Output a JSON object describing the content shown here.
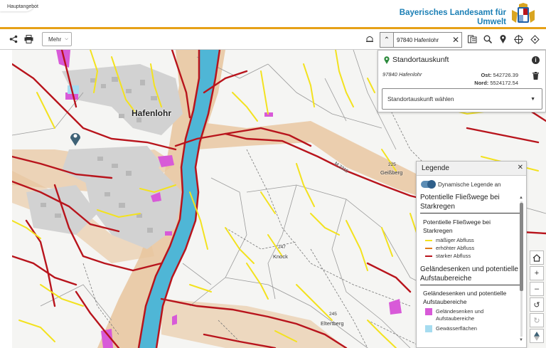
{
  "header": {
    "breadcrumb": "Hauptangebot",
    "org_line1": "Bayerisches Landesamt für",
    "org_line2": "Umwelt"
  },
  "toolbar": {
    "share_icon": "share-icon",
    "print_icon": "print-icon",
    "more_label": "Mehr",
    "search_value": "97840 Hafenlohr",
    "icons": [
      "bell-icon",
      "layers-icon",
      "zoom-search-icon",
      "location-pin-icon",
      "crosshair-icon",
      "locate-icon"
    ]
  },
  "map": {
    "places": {
      "town": "Hafenlohr",
      "geissberg_elev": "225",
      "geissberg": "Geißberg",
      "knock_elev": "247",
      "knock": "Knock",
      "eltertberg_elev": "245",
      "eltertberg": "Eltertberg",
      "road": "M 2315"
    },
    "colors": {
      "river": "#4fb6d6",
      "strong_flow": "#b8141c",
      "moderate_flow": "#f3e21f",
      "floodplain": "#e8c49c",
      "depression": "#d85ad8",
      "built": "#c9c9c9"
    }
  },
  "info_panel": {
    "title": "Standortauskunft",
    "place": "97840 Hafenlohr",
    "east_label": "Ost:",
    "east_value": "542726.39",
    "north_label": "Nord:",
    "north_value": "5524172.54",
    "select_label": "Standortauskunft wählen"
  },
  "legend": {
    "title": "Legende",
    "toggle_label": "Dynamische Legende an",
    "section1_title": "Potentielle Fließwege bei Starkregen",
    "section1_sub": "Potentielle Fließwege bei Starkregen",
    "items1": [
      {
        "label": "mäßiger Abfluss",
        "color": "#f3e21f"
      },
      {
        "label": "erhöhter Abfluss",
        "color": "#e07a1a"
      },
      {
        "label": "starker Abfluss",
        "color": "#b8141c"
      }
    ],
    "section2_title": "Geländesenken und potentielle Aufstaubereiche",
    "section2_sub": "Geländesenken und potentielle Aufstaubereiche",
    "items2": [
      {
        "label": "Geländesenken und Aufstaubereiche",
        "color": "#d85ad8"
      },
      {
        "label": "Gewässerflächen",
        "color": "#a6dcf0"
      }
    ]
  },
  "controls": [
    "home-icon",
    "zoom-in-icon",
    "zoom-out-icon",
    "rotate-icon",
    "redo-icon",
    "compass-icon"
  ]
}
